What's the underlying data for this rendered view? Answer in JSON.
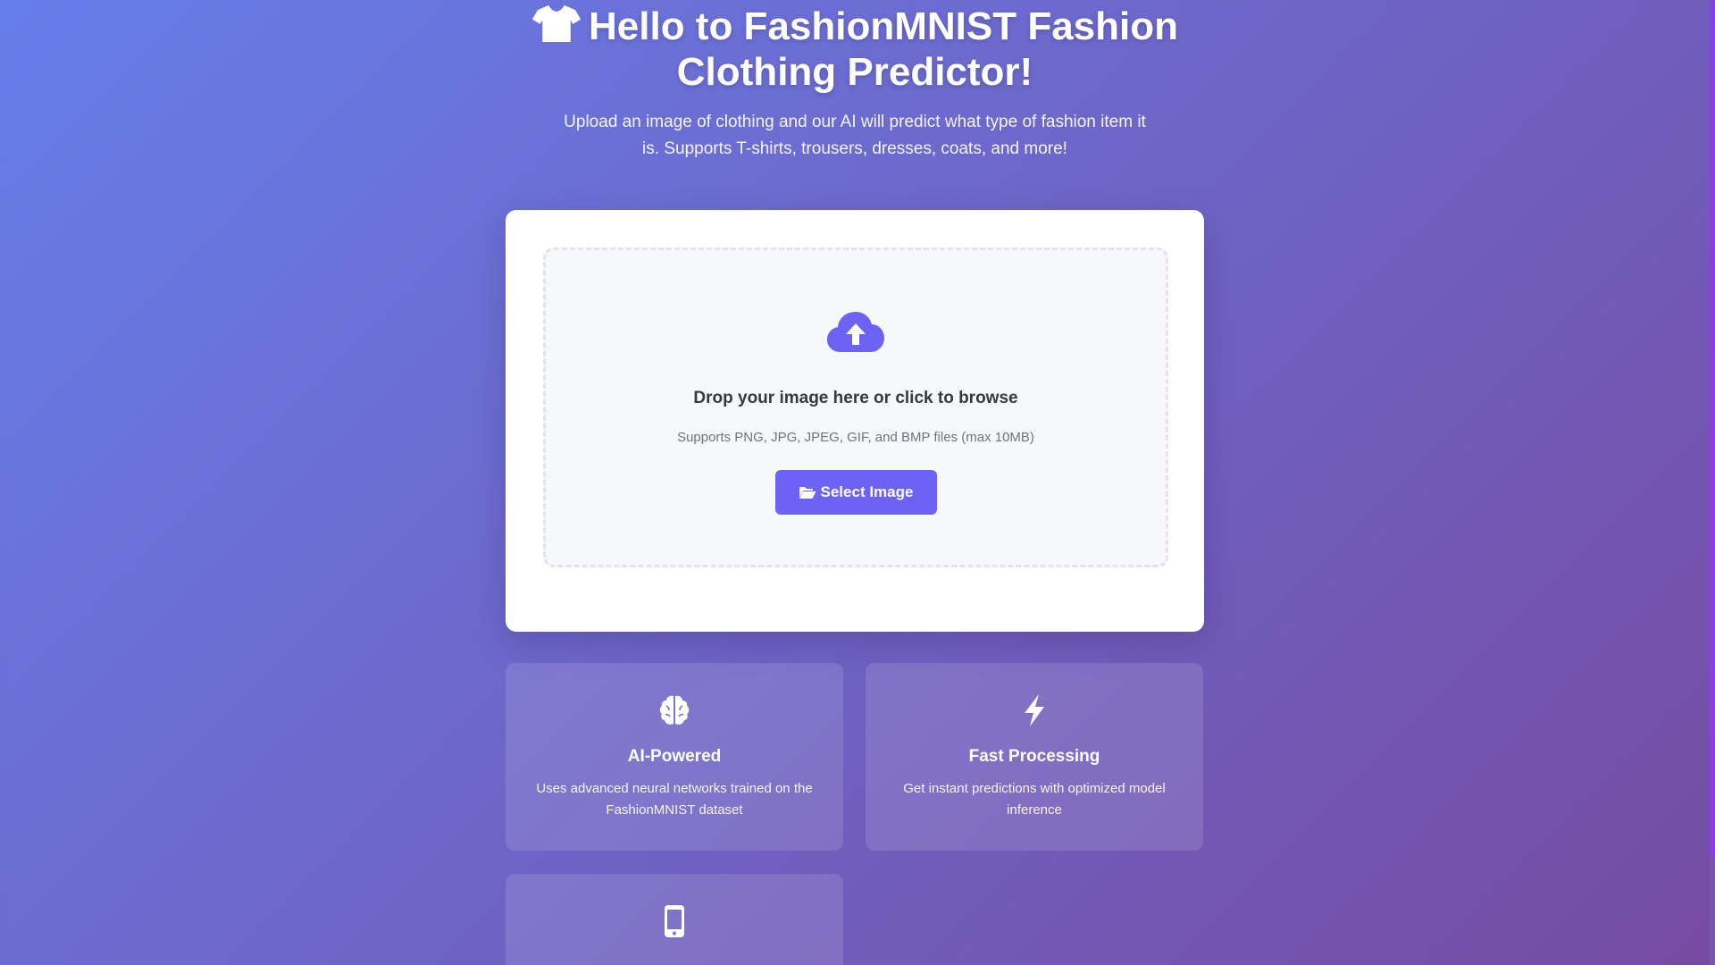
{
  "header": {
    "title": "Hello to FashionMNIST Fashion Clothing Predictor!",
    "title_icon": "tshirt-icon",
    "subtitle": "Upload an image of clothing and our AI will predict what type of fashion item it is. Supports T-shirts, trousers, dresses, coats, and more!"
  },
  "upload": {
    "icon": "cloud-upload-icon",
    "title": "Drop your image here or click to browse",
    "supported": "Supports PNG, JPG, JPEG, GIF, and BMP files (max 10MB)",
    "button_label": "Select Image",
    "button_icon": "folder-open-icon"
  },
  "features": [
    {
      "icon": "brain-icon",
      "title": "AI-Powered",
      "description": "Uses advanced neural networks trained on the FashionMNIST dataset"
    },
    {
      "icon": "bolt-icon",
      "title": "Fast Processing",
      "description": "Get instant predictions with optimized model inference"
    },
    {
      "icon": "mobile-icon",
      "title": "",
      "description": ""
    }
  ],
  "colors": {
    "gradient_start": "#667eea",
    "gradient_end": "#764ba2",
    "accent": "#6c63f4",
    "card_bg": "#ffffff",
    "dropzone_bg": "#f7f8fa"
  }
}
